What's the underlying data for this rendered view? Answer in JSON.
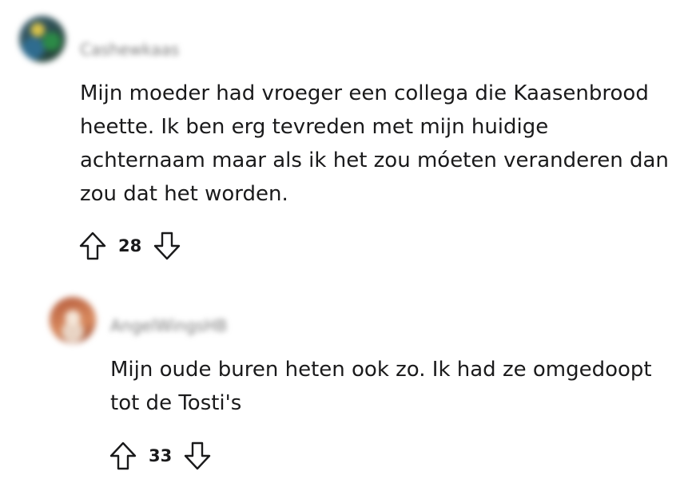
{
  "comments": [
    {
      "username": "Cashewkaas",
      "text": "Mijn moeder had vroeger een collega die Kaasenbrood heette. Ik ben erg tevreden met mijn huidige achternaam maar als ik het zou móeten veranderen dan zou dat het worden.",
      "score": "28"
    },
    {
      "username": "AngelWingsHB",
      "text": "Mijn oude buren heten ook zo. Ik had ze omgedoopt tot de Tosti's",
      "score": "33"
    }
  ],
  "icons": {
    "upvote": "upvote-arrow-icon",
    "downvote": "downvote-arrow-icon"
  },
  "colors": {
    "text": "#1a1a1b",
    "icon": "#1a1a1b",
    "background": "#ffffff"
  }
}
